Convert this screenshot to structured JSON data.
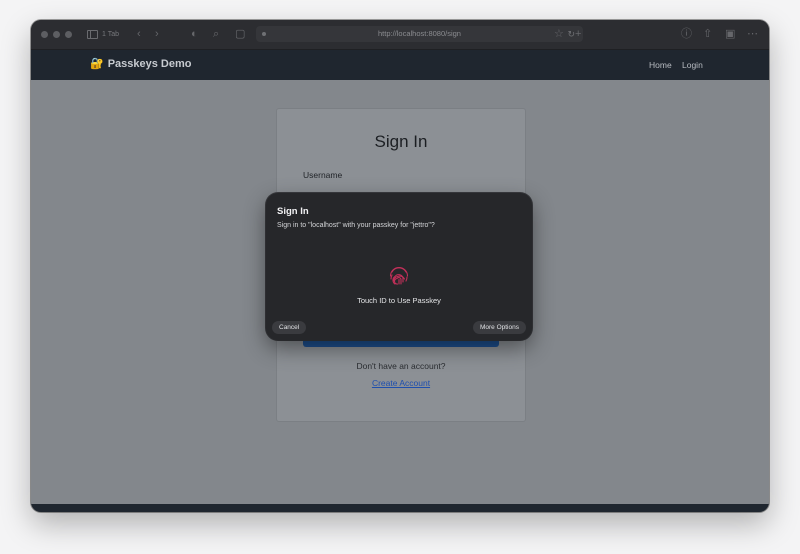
{
  "browser": {
    "tabs_button_label": "1 Tab",
    "address": "http://localhost:8080/sign"
  },
  "navbar": {
    "brand": "Passkeys Demo",
    "links": [
      "Home",
      "Login"
    ]
  },
  "card": {
    "title": "Sign In",
    "username_label": "Username",
    "signup_prompt": "Don't have an account?",
    "create_account_link": "Create Account"
  },
  "passkey_dialog": {
    "title": "Sign In",
    "message": "Sign in to \"localhost\" with your passkey for \"jettro\"?",
    "prompt": "Touch ID to Use Passkey",
    "cancel_label": "Cancel",
    "more_options_label": "More Options"
  },
  "icons": {
    "brand": "key-lock-icon",
    "auth": "fingerprint-icon"
  },
  "colors": {
    "navbar": "#1f262f",
    "link": "#1e4fae",
    "fingerprint": "#c4305a",
    "dialog": "#26272a"
  }
}
